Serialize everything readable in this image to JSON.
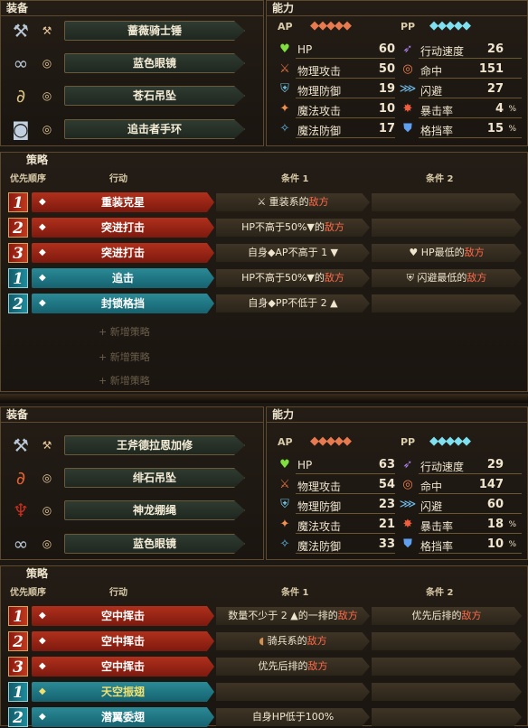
{
  "block1": {
    "equip_title": "装备",
    "equipment": [
      {
        "icon": "hammer-icon",
        "sub_icon": "hammer-small-icon",
        "name": "蔷薇骑士锤"
      },
      {
        "icon": "glasses-icon",
        "sub_icon": "ring-icon",
        "name": "蓝色眼镜"
      },
      {
        "icon": "pendant-icon",
        "sub_icon": "ring-icon",
        "name": "苍石吊坠"
      },
      {
        "icon": "gauntlet-icon",
        "sub_icon": "ring-icon",
        "name": "追击者手环"
      }
    ],
    "ability_title": "能力",
    "ap_label": "AP",
    "pp_label": "PP",
    "ap_gems": "◆◆◆◆◆",
    "pp_gems": "◆◆◆◆◆",
    "stats_left": [
      {
        "icon": "heart-icon",
        "name": "HP",
        "value": "60"
      },
      {
        "icon": "sword-icon",
        "name": "物理攻击",
        "value": "50"
      },
      {
        "icon": "armor-icon",
        "name": "物理防御",
        "value": "19"
      },
      {
        "icon": "wand-icon",
        "name": "魔法攻击",
        "value": "10"
      },
      {
        "icon": "magic-shield-icon",
        "name": "魔法防御",
        "value": "17"
      }
    ],
    "stats_right": [
      {
        "icon": "speed-icon",
        "name": "行动速度",
        "value": "26"
      },
      {
        "icon": "target-icon",
        "name": "命中",
        "value": "151"
      },
      {
        "icon": "evade-icon",
        "name": "闪避",
        "value": "27"
      },
      {
        "icon": "crit-icon",
        "name": "暴击率",
        "value": "4",
        "unit": "%"
      },
      {
        "icon": "block-icon",
        "name": "格挡率",
        "value": "15",
        "unit": "%"
      }
    ],
    "strategy_title": "策略",
    "headers": {
      "priority": "优先顺序",
      "action": "行动",
      "cond1": "条件 1",
      "cond2": "条件 2"
    },
    "strategies": [
      {
        "prio": "1",
        "color": "red",
        "action": "重装克星",
        "cond1_pre": "⚔ 重装系的",
        "cond1_post": "敌方",
        "cond2_pre": "",
        "cond2_post": ""
      },
      {
        "prio": "2",
        "color": "red",
        "action": "突进打击",
        "cond1_pre": "HP不高于50%▼的",
        "cond1_post": "敌方",
        "cond2_pre": "",
        "cond2_post": ""
      },
      {
        "prio": "3",
        "color": "red",
        "action": "突进打击",
        "cond1_pre": "自身◆AP不高于 1 ▼",
        "cond1_post": "",
        "cond2_pre": "♥ HP最低的",
        "cond2_post": "敌方"
      },
      {
        "prio": "1",
        "color": "blue",
        "action": "追击",
        "cond1_pre": "HP不高于50%▼的",
        "cond1_post": "敌方",
        "cond2_pre": "⛨ 闪避最低的",
        "cond2_post": "敌方"
      },
      {
        "prio": "2",
        "color": "blue",
        "action": "封锁格挡",
        "cond1_pre": "自身◆PP不低于 2 ▲",
        "cond1_post": "",
        "cond2_pre": "",
        "cond2_post": ""
      }
    ],
    "add_strategy": [
      "+ 新增策略",
      "+ 新增策略",
      "+ 新增策略"
    ]
  },
  "block2": {
    "equip_title": "装备",
    "equipment": [
      {
        "icon": "axe-icon",
        "sub_icon": "axe-small-icon",
        "name": "王斧德拉恩加修"
      },
      {
        "icon": "pendant-icon",
        "sub_icon": "ring-icon",
        "name": "绯石吊坠"
      },
      {
        "icon": "dragon-rope-icon",
        "sub_icon": "ring-icon",
        "name": "神龙绷绳"
      },
      {
        "icon": "glasses-icon",
        "sub_icon": "ring-icon",
        "name": "蓝色眼镜"
      }
    ],
    "ability_title": "能力",
    "ap_label": "AP",
    "pp_label": "PP",
    "ap_gems": "◆◆◆◆◆",
    "pp_gems": "◆◆◆◆◆",
    "stats_left": [
      {
        "icon": "heart-icon",
        "name": "HP",
        "value": "63"
      },
      {
        "icon": "sword-icon",
        "name": "物理攻击",
        "value": "54"
      },
      {
        "icon": "armor-icon",
        "name": "物理防御",
        "value": "23"
      },
      {
        "icon": "wand-icon",
        "name": "魔法攻击",
        "value": "21"
      },
      {
        "icon": "magic-shield-icon",
        "name": "魔法防御",
        "value": "33"
      }
    ],
    "stats_right": [
      {
        "icon": "speed-icon",
        "name": "行动速度",
        "value": "29"
      },
      {
        "icon": "target-icon",
        "name": "命中",
        "value": "147"
      },
      {
        "icon": "evade-icon",
        "name": "闪避",
        "value": "60"
      },
      {
        "icon": "crit-icon",
        "name": "暴击率",
        "value": "18",
        "unit": "%"
      },
      {
        "icon": "block-icon",
        "name": "格挡率",
        "value": "10",
        "unit": "%"
      }
    ],
    "strategy_title": "策略",
    "headers": {
      "priority": "优先顺序",
      "action": "行动",
      "cond1": "条件 1",
      "cond2": "条件 2"
    },
    "strategies": [
      {
        "prio": "1",
        "color": "red",
        "action": "空中挥击",
        "cond1_pre": "数量不少于 2 ▲的一排的",
        "cond1_post": "敌方",
        "cond2_pre": "优先后排的",
        "cond2_post": "敌方"
      },
      {
        "prio": "2",
        "color": "red",
        "action": "空中挥击",
        "cond1_pre": "骑兵系的",
        "cond1_post": "敌方",
        "cond2_pre": "",
        "cond2_post": ""
      },
      {
        "prio": "3",
        "color": "red",
        "action": "空中挥击",
        "cond1_pre": "优先后排的",
        "cond1_post": "敌方",
        "cond2_pre": "",
        "cond2_post": ""
      },
      {
        "prio": "1",
        "color": "blue",
        "action": "天空振翅",
        "cond1_pre": "",
        "cond1_post": "",
        "cond2_pre": "",
        "cond2_post": ""
      },
      {
        "prio": "2",
        "color": "blue",
        "action": "潜翼委翅",
        "cond1_pre": "自身HP低于100%",
        "cond1_post": "",
        "cond2_pre": "",
        "cond2_post": ""
      }
    ]
  },
  "colors": {
    "red": "#b0301c",
    "blue": "#2a8a96",
    "enemy": "#ff6a4a",
    "gold": "#5d4a2e"
  }
}
